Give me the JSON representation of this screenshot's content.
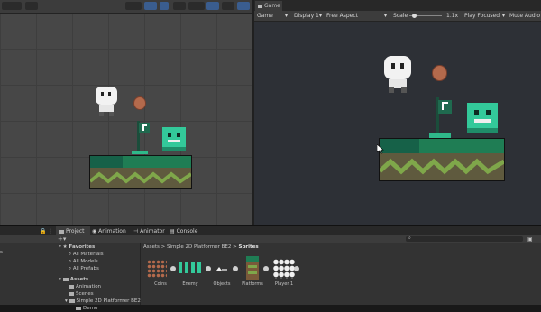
{
  "game": {
    "tab_label": "Game",
    "mode": "Game",
    "display": "Display 1",
    "aspect": "Free Aspect",
    "scale_label": "Scale",
    "scale_value": "1.1x",
    "play_mode": "Play Focused",
    "mute": "Mute Audio"
  },
  "bottom": {
    "tabs": [
      "Project",
      "Animation",
      "Animator",
      "Console"
    ],
    "favorites_label": "Favorites",
    "favorites": [
      "All Materials",
      "All Models",
      "All Prefabs"
    ],
    "assets_label": "Assets",
    "asset_tree": [
      "Animation",
      "Scenes",
      "Simple 2D Platformer BE2",
      "Demo"
    ],
    "breadcrumb": [
      "Assets",
      "Simple 2D Platformer BE2",
      "Sprites"
    ],
    "assets": [
      "Coins",
      "Enemy",
      "Objects",
      "Platforms",
      "Player 1"
    ]
  },
  "colors": {
    "platform_top": "#1f7d54",
    "platform_dirt": "#5f5a3e",
    "wave": "#7fa74a",
    "enemy": "#33c99a",
    "coin": "#b46a4c"
  }
}
